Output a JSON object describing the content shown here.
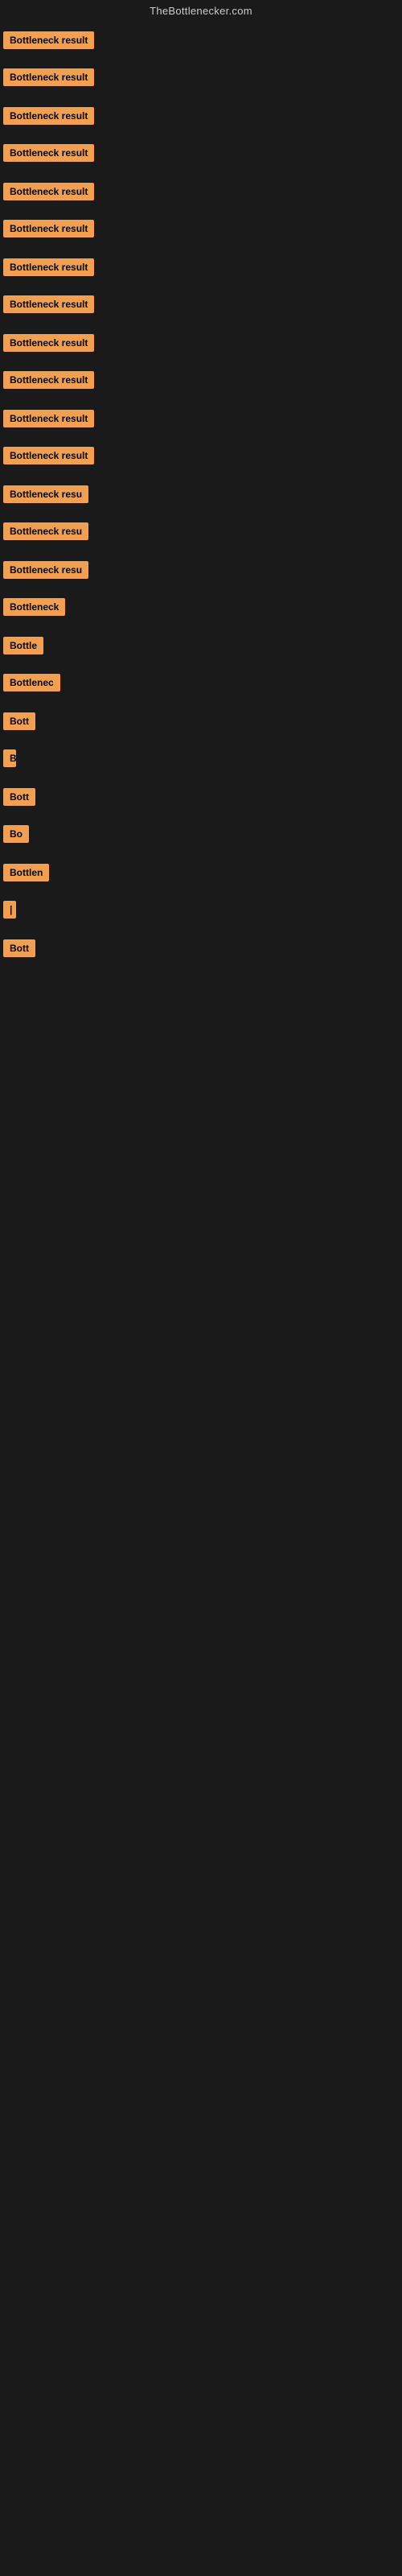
{
  "header": {
    "title": "TheBottlenecker.com"
  },
  "colors": {
    "badge_bg": "#f0a050",
    "badge_text": "#000000",
    "page_bg": "#1a1a1a",
    "title_color": "#cccccc"
  },
  "items": [
    {
      "id": 0,
      "label": "Bottleneck result",
      "badge_class": "badge-full",
      "indent": 2
    },
    {
      "id": 1,
      "label": "Bottleneck result",
      "badge_class": "badge-full",
      "indent": 2
    },
    {
      "id": 2,
      "label": "Bottleneck result",
      "badge_class": "badge-full",
      "indent": 2
    },
    {
      "id": 3,
      "label": "Bottleneck result",
      "badge_class": "badge-full",
      "indent": 2
    },
    {
      "id": 4,
      "label": "Bottleneck result",
      "badge_class": "badge-full",
      "indent": 2
    },
    {
      "id": 5,
      "label": "Bottleneck result",
      "badge_class": "badge-full",
      "indent": 2
    },
    {
      "id": 6,
      "label": "Bottleneck result",
      "badge_class": "badge-full",
      "indent": 2
    },
    {
      "id": 7,
      "label": "Bottleneck result",
      "badge_class": "badge-full",
      "indent": 2
    },
    {
      "id": 8,
      "label": "Bottleneck result",
      "badge_class": "badge-full",
      "indent": 2
    },
    {
      "id": 9,
      "label": "Bottleneck result",
      "badge_class": "badge-full",
      "indent": 2
    },
    {
      "id": 10,
      "label": "Bottleneck result",
      "badge_class": "badge-full",
      "indent": 2
    },
    {
      "id": 11,
      "label": "Bottleneck result",
      "badge_class": "badge-full",
      "indent": 2
    },
    {
      "id": 12,
      "label": "Bottleneck resu",
      "badge_class": "badge-partial",
      "indent": 2
    },
    {
      "id": 13,
      "label": "Bottleneck resu",
      "badge_class": "badge-partial",
      "indent": 2
    },
    {
      "id": 14,
      "label": "Bottleneck resu",
      "badge_class": "badge-partial",
      "indent": 2
    },
    {
      "id": 15,
      "label": "Bottleneck",
      "badge_class": "badge-small",
      "indent": 2
    },
    {
      "id": 16,
      "label": "Bottle",
      "badge_class": "badge-small",
      "indent": 2
    },
    {
      "id": 17,
      "label": "Bottlenec",
      "badge_class": "badge-small",
      "indent": 2
    },
    {
      "id": 18,
      "label": "Bott",
      "badge_class": "badge-tiny",
      "indent": 2
    },
    {
      "id": 19,
      "label": "B",
      "badge_class": "badge-micro",
      "indent": 2
    },
    {
      "id": 20,
      "label": "Bott",
      "badge_class": "badge-tiny",
      "indent": 2
    },
    {
      "id": 21,
      "label": "Bo",
      "badge_class": "badge-tiny",
      "indent": 2
    },
    {
      "id": 22,
      "label": "Bottlen",
      "badge_class": "badge-small",
      "indent": 2
    },
    {
      "id": 23,
      "label": "|",
      "badge_class": "badge-micro",
      "indent": 2
    },
    {
      "id": 24,
      "label": "Bott",
      "badge_class": "badge-tiny",
      "indent": 2
    }
  ]
}
